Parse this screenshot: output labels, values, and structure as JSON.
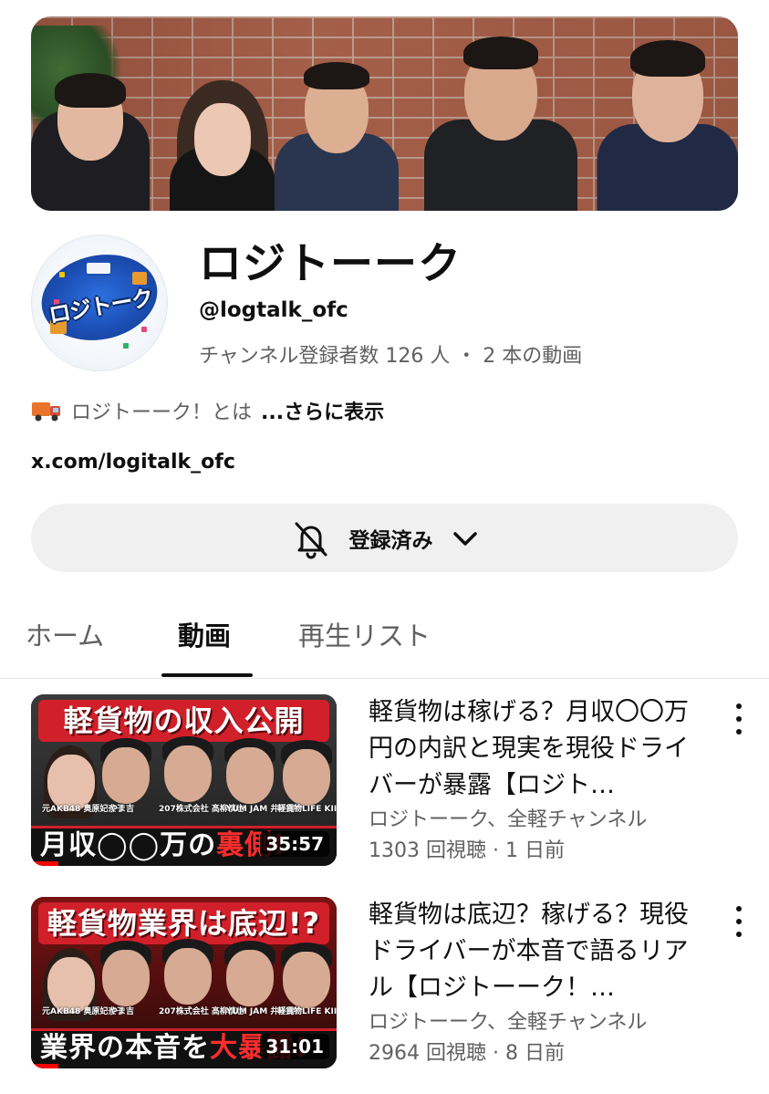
{
  "channel": {
    "name": "ロジトーーク",
    "handle": "@logtalk_ofc",
    "stats": "チャンネル登録者数 126 人 ・ 2 本の動画",
    "description": "ロジトーーク！とは",
    "more_label": "...さらに表示",
    "link": "x.com/logitalk_ofc",
    "avatar_text": "ロジトーク"
  },
  "subscribe": {
    "label": "登録済み",
    "bell_icon": "bell-off-icon",
    "chevron_icon": "chevron-down-icon"
  },
  "tabs": [
    {
      "label": "ホーム",
      "active": false
    },
    {
      "label": "動画",
      "active": true
    },
    {
      "label": "再生リスト",
      "active": false
    }
  ],
  "videos": [
    {
      "title": "軽貨物は稼げる？月収〇〇万円の内訳と現実を現役ドライバーが暴露【ロジト…",
      "channels": "ロジトーーク、全軽チャンネル",
      "views_age": "1303 回視聴 · 1 日前",
      "duration": "35:57",
      "thumb_top": "軽貨物の収入公開",
      "thumb_bottom_a": "月収◯◯万の",
      "thumb_bottom_b": "裏側!",
      "people": [
        "元AKB48 奥原妃奈子",
        "やま吉",
        "207株式会社 髙柳慎也",
        "YUM JAM 井手庸介",
        "軽貨物LIFE KIICHI"
      ]
    },
    {
      "title": "軽貨物は底辺？稼げる？現役ドライバーが本音で語るリアル【ロジトーーク！…",
      "channels": "ロジトーーク、全軽チャンネル",
      "views_age": "2964 回視聴 · 8 日前",
      "duration": "31:01",
      "thumb_top": "軽貨物業界は底辺!?",
      "thumb_bottom_a": "業界の本音を",
      "thumb_bottom_b": "大暴露!",
      "people": [
        "元AKB48 奥原妃奈子",
        "やま吉",
        "207株式会社 髙柳慎也",
        "YUM JAM 井手庸介",
        "軽貨物LIFE KIICHI"
      ]
    }
  ],
  "colors": {
    "accent_red": "#d1202a",
    "text_primary": "#0f0f0f",
    "text_secondary": "#606060",
    "button_bg": "#f0f0f0"
  }
}
